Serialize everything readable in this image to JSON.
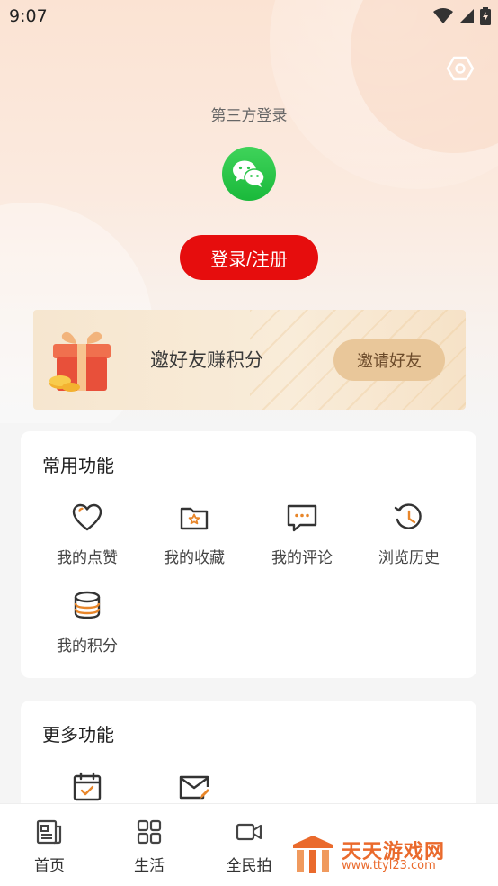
{
  "status_bar": {
    "time": "9:07"
  },
  "login": {
    "caption": "第三方登录",
    "button_label": "登录/注册"
  },
  "invite": {
    "title": "邀好友赚积分",
    "button_label": "邀请好友"
  },
  "common_functions": {
    "title": "常用功能",
    "items": [
      {
        "label": "我的点赞",
        "icon": "heart-icon"
      },
      {
        "label": "我的收藏",
        "icon": "folder-star-icon"
      },
      {
        "label": "我的评论",
        "icon": "comment-icon"
      },
      {
        "label": "浏览历史",
        "icon": "history-icon"
      },
      {
        "label": "我的积分",
        "icon": "coins-icon"
      }
    ]
  },
  "more_functions": {
    "title": "更多功能",
    "items": [
      {
        "icon": "calendar-check-icon"
      },
      {
        "icon": "mail-edit-icon"
      }
    ]
  },
  "tabbar": {
    "items": [
      {
        "label": "首页",
        "icon": "news-icon"
      },
      {
        "label": "生活",
        "icon": "grid-icon"
      },
      {
        "label": "全民拍",
        "icon": "video-camera-icon"
      }
    ]
  },
  "watermark": {
    "text": "天天游戏网",
    "url": "www.ttyl23.com"
  },
  "colors": {
    "accent_red": "#e60d0d",
    "icon_orange": "#e8862a",
    "icon_dark": "#333333",
    "wechat_green": "#1ab93b",
    "invite_button": "#e9c79a"
  }
}
